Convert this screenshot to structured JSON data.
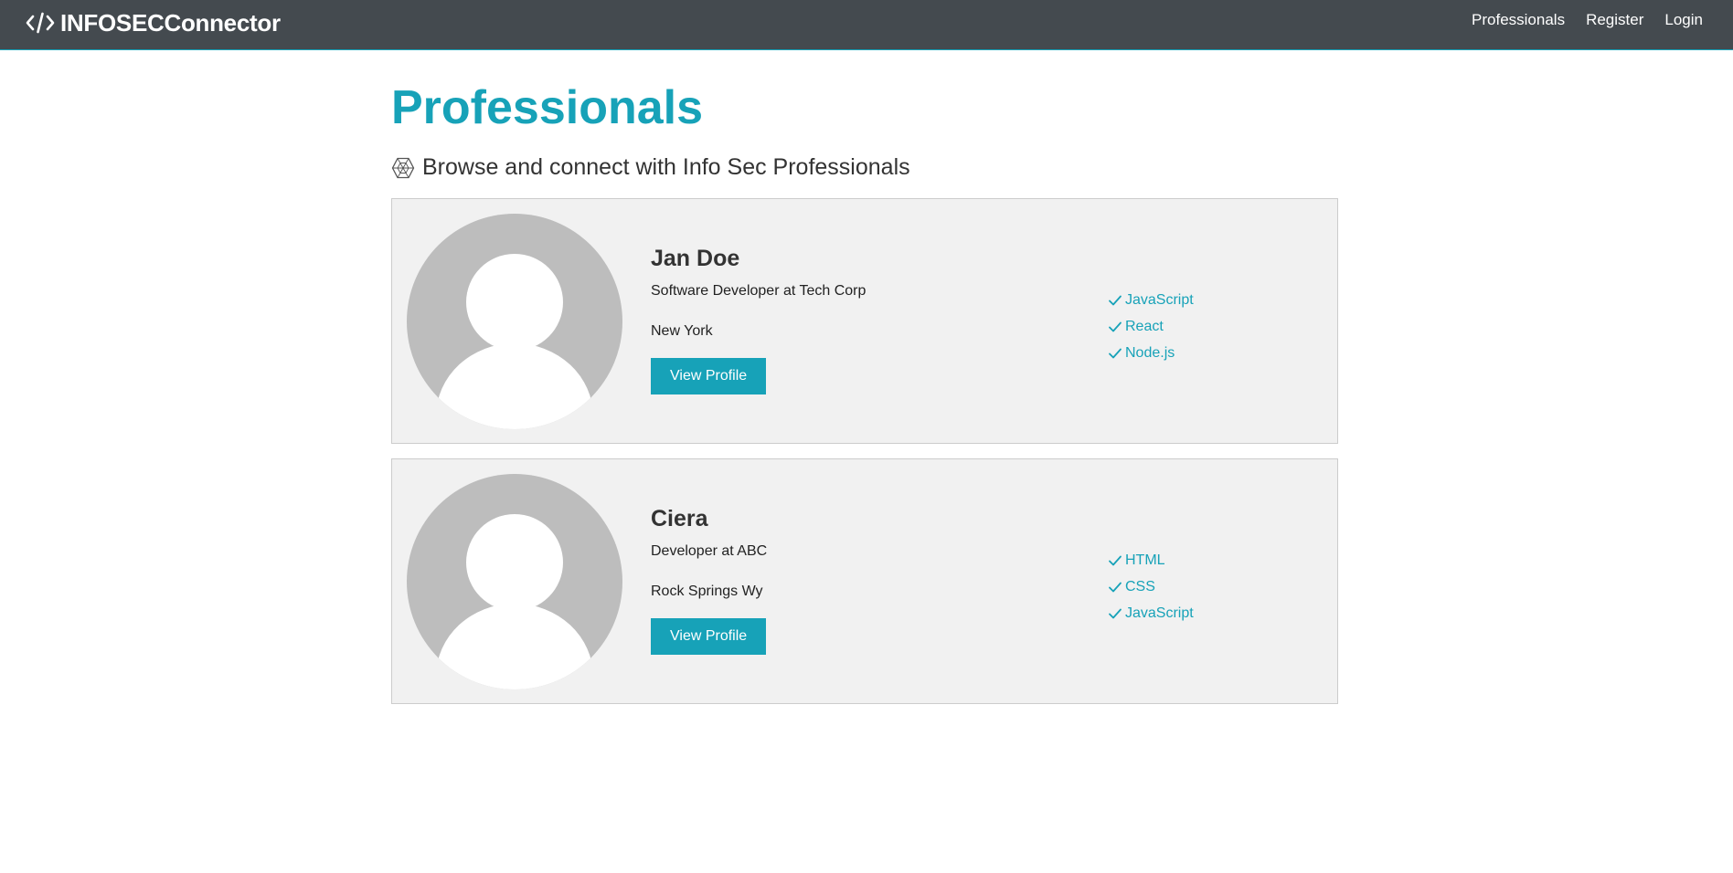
{
  "navbar": {
    "brand": "INFOSECConnector",
    "brand_icon": "code-icon",
    "links": [
      {
        "label": "Professionals"
      },
      {
        "label": "Register"
      },
      {
        "label": "Login"
      }
    ]
  },
  "page": {
    "title": "Professionals",
    "lead_icon": "connectdevelop-icon",
    "lead": "Browse and connect with Info Sec Professionals"
  },
  "profiles": [
    {
      "name": "Jan Doe",
      "status": "Software Developer at Tech Corp",
      "location": "New York",
      "button": "View Profile",
      "skills": [
        "JavaScript",
        "React",
        "Node.js"
      ]
    },
    {
      "name": "Ciera",
      "status": "Developer at ABC",
      "location": "Rock Springs Wy",
      "button": "View Profile",
      "skills": [
        "HTML",
        "CSS",
        "JavaScript"
      ]
    }
  ],
  "colors": {
    "navbar_bg": "#444a4f",
    "accent": "#17a2b8",
    "card_bg": "#f1f1f1",
    "avatar_bg": "#bdbdbd"
  }
}
